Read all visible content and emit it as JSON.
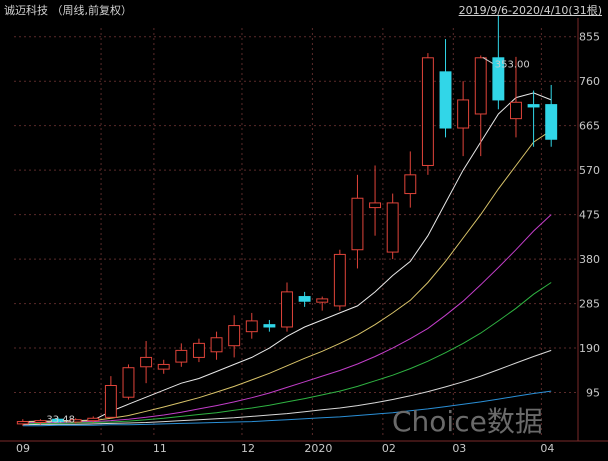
{
  "header": {
    "title": "诚迈科技 （周线,前复权）",
    "range": "2019/9/6-2020/4/10(31根)"
  },
  "watermark": "Choice数据",
  "colors": {
    "background": "#000000",
    "up": "#e0443a",
    "down": "#31d6e8",
    "grid": "#5a2a2a",
    "axis_text": "#c8c8c8"
  },
  "chart_data": {
    "type": "candlestick",
    "y_ticks": [
      95,
      190,
      285,
      380,
      475,
      570,
      665,
      760,
      855
    ],
    "ylim": [
      0,
      895
    ],
    "x_labels": [
      {
        "index": 0,
        "label": "09"
      },
      {
        "index": 5,
        "label": "10"
      },
      {
        "index": 8,
        "label": "11"
      },
      {
        "index": 13,
        "label": "12"
      },
      {
        "index": 17,
        "label": "2020"
      },
      {
        "index": 21,
        "label": "02"
      },
      {
        "index": 25,
        "label": "03"
      },
      {
        "index": 30,
        "label": "04"
      }
    ],
    "annotations": [
      {
        "label": "353.00",
        "index": 26
      },
      {
        "label": "33.48",
        "index": 1
      }
    ],
    "candles": [
      {
        "o": 28,
        "h": 38,
        "l": 24,
        "c": 33
      },
      {
        "o": 31,
        "h": 38,
        "l": 27,
        "c": 35
      },
      {
        "o": 38,
        "h": 42,
        "l": 30,
        "c": 33
      },
      {
        "o": 32,
        "h": 40,
        "l": 29,
        "c": 37
      },
      {
        "o": 35,
        "h": 44,
        "l": 31,
        "c": 40
      },
      {
        "o": 42,
        "h": 130,
        "l": 40,
        "c": 110
      },
      {
        "o": 85,
        "h": 155,
        "l": 80,
        "c": 148
      },
      {
        "o": 150,
        "h": 205,
        "l": 115,
        "c": 170
      },
      {
        "o": 145,
        "h": 165,
        "l": 135,
        "c": 155
      },
      {
        "o": 160,
        "h": 200,
        "l": 150,
        "c": 185
      },
      {
        "o": 170,
        "h": 210,
        "l": 160,
        "c": 200
      },
      {
        "o": 182,
        "h": 225,
        "l": 165,
        "c": 212
      },
      {
        "o": 195,
        "h": 260,
        "l": 170,
        "c": 238
      },
      {
        "o": 225,
        "h": 265,
        "l": 210,
        "c": 248
      },
      {
        "o": 240,
        "h": 250,
        "l": 225,
        "c": 235
      },
      {
        "o": 235,
        "h": 330,
        "l": 225,
        "c": 310
      },
      {
        "o": 300,
        "h": 310,
        "l": 278,
        "c": 290
      },
      {
        "o": 288,
        "h": 300,
        "l": 270,
        "c": 295
      },
      {
        "o": 280,
        "h": 400,
        "l": 270,
        "c": 390
      },
      {
        "o": 400,
        "h": 560,
        "l": 360,
        "c": 510
      },
      {
        "o": 490,
        "h": 580,
        "l": 430,
        "c": 500
      },
      {
        "o": 395,
        "h": 520,
        "l": 380,
        "c": 500
      },
      {
        "o": 520,
        "h": 610,
        "l": 490,
        "c": 560
      },
      {
        "o": 580,
        "h": 820,
        "l": 560,
        "c": 810
      },
      {
        "o": 780,
        "h": 850,
        "l": 640,
        "c": 660
      },
      {
        "o": 660,
        "h": 760,
        "l": 600,
        "c": 720
      },
      {
        "o": 690,
        "h": 815,
        "l": 600,
        "c": 810
      },
      {
        "o": 810,
        "h": 900,
        "l": 700,
        "c": 720
      },
      {
        "o": 680,
        "h": 812,
        "l": 640,
        "c": 715
      },
      {
        "o": 710,
        "h": 740,
        "l": 620,
        "c": 705
      },
      {
        "o": 710,
        "h": 752,
        "l": 620,
        "c": 636
      }
    ],
    "moving_averages": [
      {
        "color": "#e8e8e8",
        "values": [
          33,
          34,
          34,
          35,
          36,
          55,
          70,
          85,
          100,
          115,
          125,
          140,
          155,
          170,
          190,
          215,
          235,
          250,
          265,
          280,
          310,
          345,
          375,
          430,
          500,
          570,
          630,
          690,
          725,
          735,
          720
        ]
      },
      {
        "color": "#d9c46a",
        "values": [
          32,
          33,
          33,
          34,
          35,
          40,
          46,
          55,
          64,
          74,
          84,
          96,
          108,
          122,
          136,
          152,
          168,
          183,
          200,
          218,
          240,
          265,
          292,
          330,
          375,
          425,
          475,
          530,
          580,
          630,
          655
        ]
      },
      {
        "color": "#c23ec9",
        "values": [
          30,
          31,
          31,
          32,
          33,
          35,
          38,
          42,
          47,
          53,
          60,
          67,
          75,
          84,
          94,
          106,
          118,
          130,
          142,
          156,
          172,
          190,
          210,
          232,
          260,
          290,
          325,
          362,
          400,
          440,
          475
        ]
      },
      {
        "color": "#2fb342",
        "values": [
          28,
          29,
          29,
          30,
          31,
          32,
          34,
          37,
          40,
          44,
          48,
          52,
          57,
          62,
          68,
          75,
          82,
          90,
          98,
          108,
          120,
          132,
          146,
          162,
          180,
          200,
          222,
          248,
          275,
          305,
          330
        ]
      },
      {
        "color": "#d8d8d8",
        "values": [
          26,
          27,
          27,
          27,
          28,
          29,
          30,
          31,
          33,
          35,
          37,
          39,
          41,
          44,
          47,
          50,
          54,
          58,
          62,
          67,
          73,
          80,
          88,
          97,
          107,
          118,
          130,
          144,
          158,
          172,
          185
        ]
      },
      {
        "color": "#2a8fd6",
        "values": [
          24,
          24,
          25,
          25,
          25,
          26,
          26,
          27,
          28,
          29,
          30,
          31,
          32,
          33,
          35,
          37,
          39,
          41,
          43,
          46,
          49,
          52,
          56,
          60,
          65,
          70,
          75,
          81,
          87,
          93,
          98
        ]
      }
    ]
  }
}
